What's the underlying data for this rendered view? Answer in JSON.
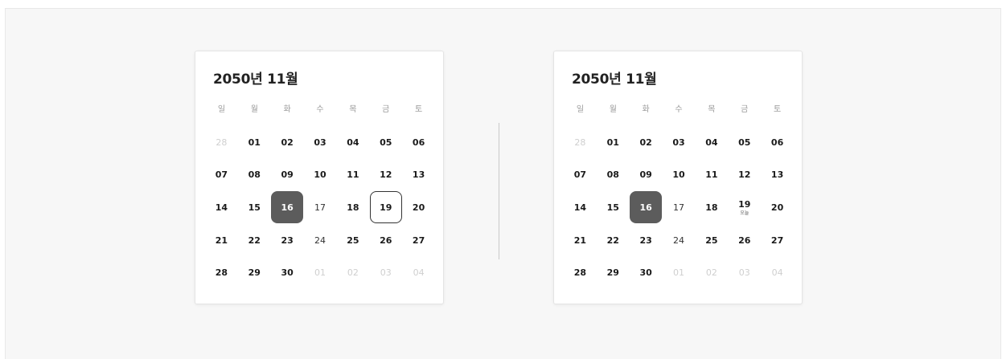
{
  "calendars": [
    {
      "title": "2050년 11월",
      "weekdays": [
        "일",
        "월",
        "화",
        "수",
        "목",
        "금",
        "토"
      ],
      "today_label": "",
      "days": [
        {
          "label": "28",
          "state": "other"
        },
        {
          "label": "01",
          "state": "normal"
        },
        {
          "label": "02",
          "state": "normal"
        },
        {
          "label": "03",
          "state": "normal"
        },
        {
          "label": "04",
          "state": "normal"
        },
        {
          "label": "05",
          "state": "normal"
        },
        {
          "label": "06",
          "state": "normal"
        },
        {
          "label": "07",
          "state": "normal"
        },
        {
          "label": "08",
          "state": "normal"
        },
        {
          "label": "09",
          "state": "normal"
        },
        {
          "label": "10",
          "state": "normal"
        },
        {
          "label": "11",
          "state": "normal"
        },
        {
          "label": "12",
          "state": "normal"
        },
        {
          "label": "13",
          "state": "normal"
        },
        {
          "label": "14",
          "state": "normal"
        },
        {
          "label": "15",
          "state": "normal"
        },
        {
          "label": "16",
          "state": "selected"
        },
        {
          "label": "17",
          "state": "light"
        },
        {
          "label": "18",
          "state": "normal"
        },
        {
          "label": "19",
          "state": "today-outline"
        },
        {
          "label": "20",
          "state": "normal"
        },
        {
          "label": "21",
          "state": "normal"
        },
        {
          "label": "22",
          "state": "normal"
        },
        {
          "label": "23",
          "state": "normal"
        },
        {
          "label": "24",
          "state": "light"
        },
        {
          "label": "25",
          "state": "normal"
        },
        {
          "label": "26",
          "state": "normal"
        },
        {
          "label": "27",
          "state": "normal"
        },
        {
          "label": "28",
          "state": "normal"
        },
        {
          "label": "29",
          "state": "normal"
        },
        {
          "label": "30",
          "state": "normal"
        },
        {
          "label": "01",
          "state": "other"
        },
        {
          "label": "02",
          "state": "other"
        },
        {
          "label": "03",
          "state": "other"
        },
        {
          "label": "04",
          "state": "other"
        }
      ]
    },
    {
      "title": "2050년 11월",
      "weekdays": [
        "일",
        "월",
        "화",
        "수",
        "목",
        "금",
        "토"
      ],
      "today_label": "오늘",
      "days": [
        {
          "label": "28",
          "state": "other"
        },
        {
          "label": "01",
          "state": "normal"
        },
        {
          "label": "02",
          "state": "normal"
        },
        {
          "label": "03",
          "state": "normal"
        },
        {
          "label": "04",
          "state": "normal"
        },
        {
          "label": "05",
          "state": "normal"
        },
        {
          "label": "06",
          "state": "normal"
        },
        {
          "label": "07",
          "state": "normal"
        },
        {
          "label": "08",
          "state": "normal"
        },
        {
          "label": "09",
          "state": "normal"
        },
        {
          "label": "10",
          "state": "normal"
        },
        {
          "label": "11",
          "state": "normal"
        },
        {
          "label": "12",
          "state": "normal"
        },
        {
          "label": "13",
          "state": "normal"
        },
        {
          "label": "14",
          "state": "normal"
        },
        {
          "label": "15",
          "state": "normal"
        },
        {
          "label": "16",
          "state": "selected"
        },
        {
          "label": "17",
          "state": "light"
        },
        {
          "label": "18",
          "state": "normal"
        },
        {
          "label": "19",
          "state": "today-label"
        },
        {
          "label": "20",
          "state": "normal"
        },
        {
          "label": "21",
          "state": "normal"
        },
        {
          "label": "22",
          "state": "normal"
        },
        {
          "label": "23",
          "state": "normal"
        },
        {
          "label": "24",
          "state": "light"
        },
        {
          "label": "25",
          "state": "normal"
        },
        {
          "label": "26",
          "state": "normal"
        },
        {
          "label": "27",
          "state": "normal"
        },
        {
          "label": "28",
          "state": "normal"
        },
        {
          "label": "29",
          "state": "normal"
        },
        {
          "label": "30",
          "state": "normal"
        },
        {
          "label": "01",
          "state": "other"
        },
        {
          "label": "02",
          "state": "other"
        },
        {
          "label": "03",
          "state": "other"
        },
        {
          "label": "04",
          "state": "other"
        }
      ]
    }
  ],
  "colors": {
    "selected_bg": "#5c5c5c",
    "today_outline": "#333333",
    "other_month_text": "#cfcfcf"
  }
}
